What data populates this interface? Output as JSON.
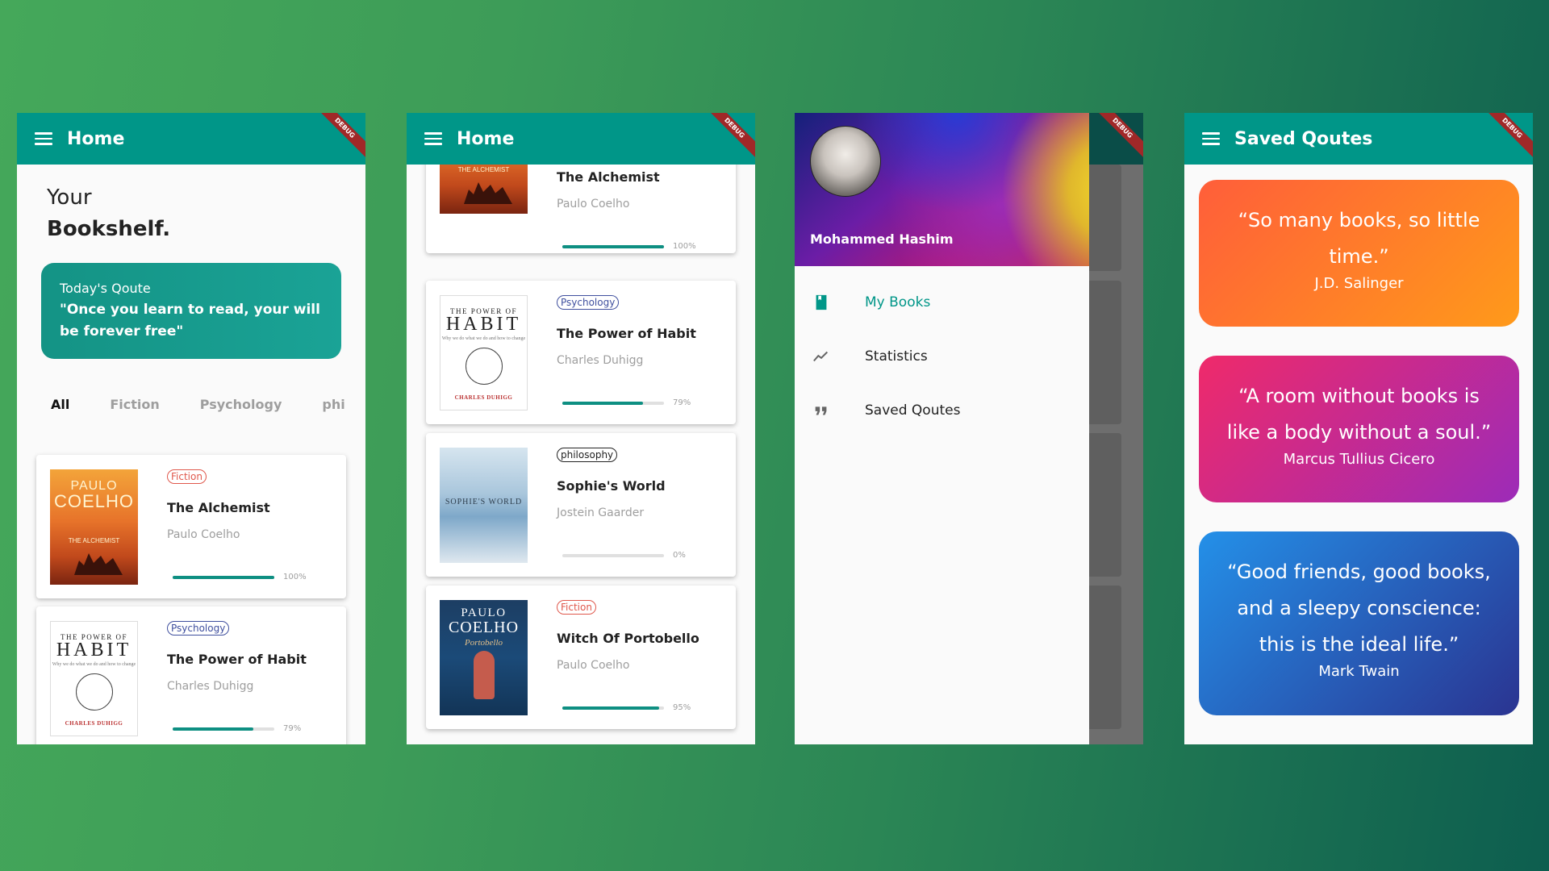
{
  "screens": {
    "home_top": {
      "appbar_title": "Home",
      "heading_line1": "Your",
      "heading_line2": "Bookshelf.",
      "quote_label": "Today's Qoute",
      "quote_text": "\"Once you learn to read, your will be forever free\"",
      "filters": [
        "All",
        "Fiction",
        "Psychology",
        "phi"
      ],
      "active_filter": "All",
      "books": [
        {
          "tag": "Fiction",
          "title": "The Alchemist",
          "author": "Paulo Coelho",
          "progress": 100,
          "progress_label": "100%"
        },
        {
          "tag": "Psychology",
          "title": "The Power of Habit",
          "author": "Charles Duhigg",
          "progress": 79,
          "progress_label": "79%"
        }
      ]
    },
    "home_scrolled": {
      "appbar_title": "Home",
      "books": [
        {
          "tag": "",
          "title": "The Alchemist",
          "author": "Paulo Coelho",
          "progress": 100,
          "progress_label": "100%"
        },
        {
          "tag": "Psychology",
          "title": "The Power of Habit",
          "author": "Charles Duhigg",
          "progress": 79,
          "progress_label": "79%"
        },
        {
          "tag": "philosophy",
          "title": "Sophie's World",
          "author": "Jostein Gaarder",
          "progress": 0,
          "progress_label": "0%"
        },
        {
          "tag": "Fiction",
          "title": "Witch Of Portobello",
          "author": "Paulo Coelho",
          "progress": 95,
          "progress_label": "95%"
        }
      ]
    },
    "drawer": {
      "user_name": "Mohammed Hashim",
      "items": [
        {
          "label": "My Books",
          "icon": "book-icon",
          "active": true
        },
        {
          "label": "Statistics",
          "icon": "trending-icon",
          "active": false
        },
        {
          "label": "Saved Qoutes",
          "icon": "quote-icon",
          "active": false
        }
      ]
    },
    "saved_quotes": {
      "appbar_title": "Saved Qoutes",
      "quotes": [
        {
          "text": "“So many books, so little time.”",
          "author": "J.D. Salinger",
          "gradient": [
            "#ff5e3a",
            "#ff9a1a"
          ]
        },
        {
          "text": "“A room without books is like a body without a soul.”",
          "author": "Marcus Tullius Cicero",
          "gradient": [
            "#ef2a6a",
            "#9c2bb8"
          ]
        },
        {
          "text": "“Good friends, good books, and a sleepy conscience: this is the ideal life.”",
          "author": "Mark Twain",
          "gradient": [
            "#2490e8",
            "#2a3491"
          ]
        }
      ]
    }
  },
  "covers": {
    "alchemist": {
      "author": "PAULO",
      "author2": "COELHO",
      "title": "THE ALCHEMIST"
    },
    "habit": {
      "top": "THE POWER OF",
      "main": "HABIT",
      "sub": "Why we do what we do and how to change",
      "author": "CHARLES DUHIGG"
    },
    "sophie": {
      "title": "SOPHIE'S WORLD"
    },
    "portobello": {
      "author": "PAULO",
      "author2": "COELHO",
      "title": "Portobello"
    }
  },
  "debug_label": "DEBUG",
  "colors": {
    "primary": "#009688",
    "accent": "#0e8f82"
  }
}
